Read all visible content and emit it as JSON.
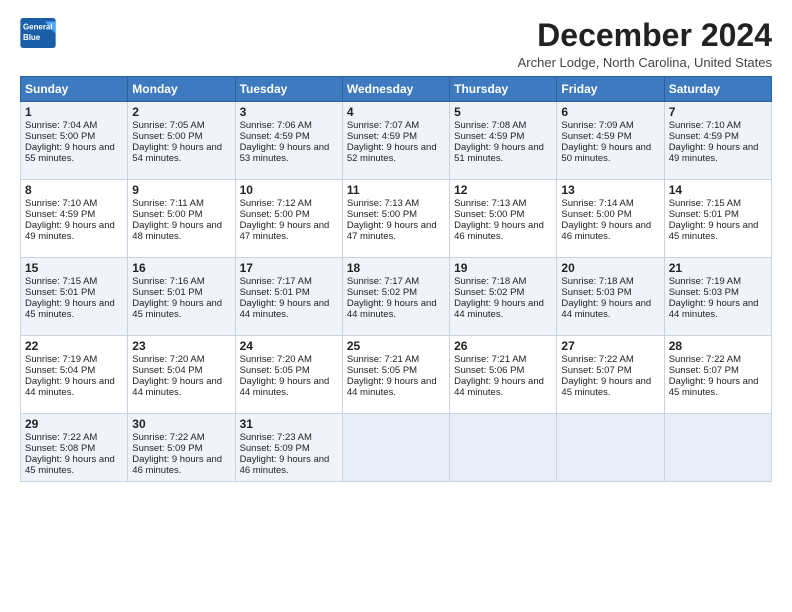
{
  "logo": {
    "line1": "General",
    "line2": "Blue"
  },
  "title": "December 2024",
  "subtitle": "Archer Lodge, North Carolina, United States",
  "headers": [
    "Sunday",
    "Monday",
    "Tuesday",
    "Wednesday",
    "Thursday",
    "Friday",
    "Saturday"
  ],
  "weeks": [
    [
      {
        "day": "1",
        "rise": "Sunrise: 7:04 AM",
        "set": "Sunset: 5:00 PM",
        "daylight": "Daylight: 9 hours and 55 minutes."
      },
      {
        "day": "2",
        "rise": "Sunrise: 7:05 AM",
        "set": "Sunset: 5:00 PM",
        "daylight": "Daylight: 9 hours and 54 minutes."
      },
      {
        "day": "3",
        "rise": "Sunrise: 7:06 AM",
        "set": "Sunset: 4:59 PM",
        "daylight": "Daylight: 9 hours and 53 minutes."
      },
      {
        "day": "4",
        "rise": "Sunrise: 7:07 AM",
        "set": "Sunset: 4:59 PM",
        "daylight": "Daylight: 9 hours and 52 minutes."
      },
      {
        "day": "5",
        "rise": "Sunrise: 7:08 AM",
        "set": "Sunset: 4:59 PM",
        "daylight": "Daylight: 9 hours and 51 minutes."
      },
      {
        "day": "6",
        "rise": "Sunrise: 7:09 AM",
        "set": "Sunset: 4:59 PM",
        "daylight": "Daylight: 9 hours and 50 minutes."
      },
      {
        "day": "7",
        "rise": "Sunrise: 7:10 AM",
        "set": "Sunset: 4:59 PM",
        "daylight": "Daylight: 9 hours and 49 minutes."
      }
    ],
    [
      {
        "day": "8",
        "rise": "Sunrise: 7:10 AM",
        "set": "Sunset: 4:59 PM",
        "daylight": "Daylight: 9 hours and 49 minutes."
      },
      {
        "day": "9",
        "rise": "Sunrise: 7:11 AM",
        "set": "Sunset: 5:00 PM",
        "daylight": "Daylight: 9 hours and 48 minutes."
      },
      {
        "day": "10",
        "rise": "Sunrise: 7:12 AM",
        "set": "Sunset: 5:00 PM",
        "daylight": "Daylight: 9 hours and 47 minutes."
      },
      {
        "day": "11",
        "rise": "Sunrise: 7:13 AM",
        "set": "Sunset: 5:00 PM",
        "daylight": "Daylight: 9 hours and 47 minutes."
      },
      {
        "day": "12",
        "rise": "Sunrise: 7:13 AM",
        "set": "Sunset: 5:00 PM",
        "daylight": "Daylight: 9 hours and 46 minutes."
      },
      {
        "day": "13",
        "rise": "Sunrise: 7:14 AM",
        "set": "Sunset: 5:00 PM",
        "daylight": "Daylight: 9 hours and 46 minutes."
      },
      {
        "day": "14",
        "rise": "Sunrise: 7:15 AM",
        "set": "Sunset: 5:01 PM",
        "daylight": "Daylight: 9 hours and 45 minutes."
      }
    ],
    [
      {
        "day": "15",
        "rise": "Sunrise: 7:15 AM",
        "set": "Sunset: 5:01 PM",
        "daylight": "Daylight: 9 hours and 45 minutes."
      },
      {
        "day": "16",
        "rise": "Sunrise: 7:16 AM",
        "set": "Sunset: 5:01 PM",
        "daylight": "Daylight: 9 hours and 45 minutes."
      },
      {
        "day": "17",
        "rise": "Sunrise: 7:17 AM",
        "set": "Sunset: 5:01 PM",
        "daylight": "Daylight: 9 hours and 44 minutes."
      },
      {
        "day": "18",
        "rise": "Sunrise: 7:17 AM",
        "set": "Sunset: 5:02 PM",
        "daylight": "Daylight: 9 hours and 44 minutes."
      },
      {
        "day": "19",
        "rise": "Sunrise: 7:18 AM",
        "set": "Sunset: 5:02 PM",
        "daylight": "Daylight: 9 hours and 44 minutes."
      },
      {
        "day": "20",
        "rise": "Sunrise: 7:18 AM",
        "set": "Sunset: 5:03 PM",
        "daylight": "Daylight: 9 hours and 44 minutes."
      },
      {
        "day": "21",
        "rise": "Sunrise: 7:19 AM",
        "set": "Sunset: 5:03 PM",
        "daylight": "Daylight: 9 hours and 44 minutes."
      }
    ],
    [
      {
        "day": "22",
        "rise": "Sunrise: 7:19 AM",
        "set": "Sunset: 5:04 PM",
        "daylight": "Daylight: 9 hours and 44 minutes."
      },
      {
        "day": "23",
        "rise": "Sunrise: 7:20 AM",
        "set": "Sunset: 5:04 PM",
        "daylight": "Daylight: 9 hours and 44 minutes."
      },
      {
        "day": "24",
        "rise": "Sunrise: 7:20 AM",
        "set": "Sunset: 5:05 PM",
        "daylight": "Daylight: 9 hours and 44 minutes."
      },
      {
        "day": "25",
        "rise": "Sunrise: 7:21 AM",
        "set": "Sunset: 5:05 PM",
        "daylight": "Daylight: 9 hours and 44 minutes."
      },
      {
        "day": "26",
        "rise": "Sunrise: 7:21 AM",
        "set": "Sunset: 5:06 PM",
        "daylight": "Daylight: 9 hours and 44 minutes."
      },
      {
        "day": "27",
        "rise": "Sunrise: 7:22 AM",
        "set": "Sunset: 5:07 PM",
        "daylight": "Daylight: 9 hours and 45 minutes."
      },
      {
        "day": "28",
        "rise": "Sunrise: 7:22 AM",
        "set": "Sunset: 5:07 PM",
        "daylight": "Daylight: 9 hours and 45 minutes."
      }
    ],
    [
      {
        "day": "29",
        "rise": "Sunrise: 7:22 AM",
        "set": "Sunset: 5:08 PM",
        "daylight": "Daylight: 9 hours and 45 minutes."
      },
      {
        "day": "30",
        "rise": "Sunrise: 7:22 AM",
        "set": "Sunset: 5:09 PM",
        "daylight": "Daylight: 9 hours and 46 minutes."
      },
      {
        "day": "31",
        "rise": "Sunrise: 7:23 AM",
        "set": "Sunset: 5:09 PM",
        "daylight": "Daylight: 9 hours and 46 minutes."
      },
      null,
      null,
      null,
      null
    ]
  ]
}
